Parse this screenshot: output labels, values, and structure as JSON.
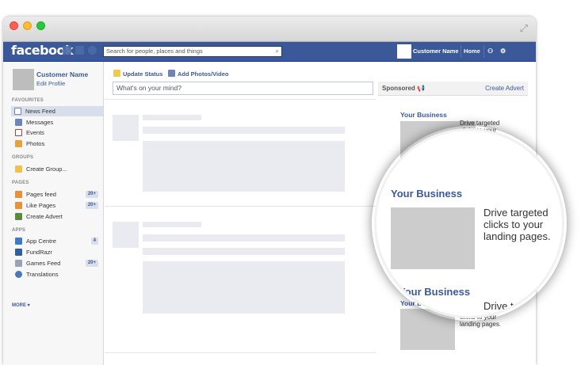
{
  "window": {
    "traffic_lights": {
      "close": "#ff5f57",
      "minimize": "#febc2e",
      "zoom": "#28c840"
    },
    "expand_icon": "expand-arrows-icon"
  },
  "topbar": {
    "logo": "facebook",
    "icons": [
      "friend-requests-icon",
      "messages-icon",
      "notifications-globe-icon"
    ],
    "search_placeholder": "Search for people, places and things",
    "user_name": "Customer Name",
    "home_label": "Home",
    "right_icons": [
      "find-friends-icon",
      "settings-gear-icon"
    ],
    "brand_color": "#3b5998"
  },
  "sidebar": {
    "profile_name": "Customer Name",
    "edit_profile": "Edit Profile",
    "sections": [
      {
        "heading": "FAVOURITES",
        "items": [
          {
            "label": "News Feed",
            "icon": "news-feed-icon",
            "selected": true
          },
          {
            "label": "Messages",
            "icon": "messages-icon"
          },
          {
            "label": "Events",
            "icon": "events-calendar-icon"
          },
          {
            "label": "Photos",
            "icon": "photos-icon"
          }
        ]
      },
      {
        "heading": "GROUPS",
        "items": [
          {
            "label": "Create Group...",
            "icon": "create-group-icon"
          }
        ]
      },
      {
        "heading": "PAGES",
        "items": [
          {
            "label": "Pages feed",
            "icon": "pages-feed-icon",
            "badge": "20+"
          },
          {
            "label": "Like Pages",
            "icon": "like-pages-icon",
            "badge": "20+"
          },
          {
            "label": "Create Advert",
            "icon": "create-advert-icon"
          }
        ]
      },
      {
        "heading": "APPS",
        "items": [
          {
            "label": "App Centre",
            "icon": "app-centre-icon",
            "badge": "4"
          },
          {
            "label": "FundRazr",
            "icon": "fundrazr-icon"
          },
          {
            "label": "Games Feed",
            "icon": "games-feed-icon",
            "badge": "20+"
          },
          {
            "label": "Translations",
            "icon": "translations-icon"
          }
        ]
      }
    ],
    "more": "MORE ▾"
  },
  "composer": {
    "update_status": "Update Status",
    "add_photos": "Add Photos/Video",
    "placeholder": "What's on your mind?"
  },
  "ads": {
    "sponsored": "Sponsored",
    "create_advert": "Create Advert",
    "title": "Your Business",
    "text_line1": "Drive targeted",
    "text_line2": "clicks to your",
    "text_line3": "landing pages."
  }
}
